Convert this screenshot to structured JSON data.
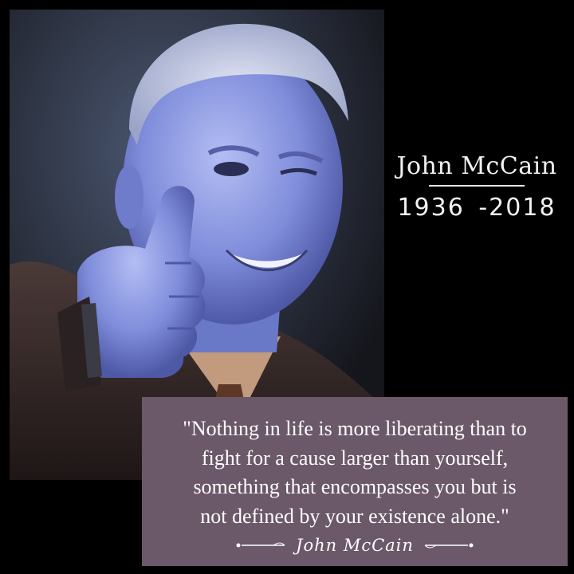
{
  "portrait": {
    "subject": "John McCain"
  },
  "name_block": {
    "name": "John McCain",
    "years": "1936 -2018"
  },
  "quote": {
    "lines": [
      "\"Nothing in life is more liberating than to",
      "fight for a cause larger than yourself,",
      "something that encompasses you but is",
      "not defined by your existence alone.\""
    ],
    "attribution": "John McCain"
  },
  "colors": {
    "background": "#000000",
    "quote_box": "#6b5869",
    "text": "#ffffff",
    "skin_tint": "#8c9ae0"
  }
}
